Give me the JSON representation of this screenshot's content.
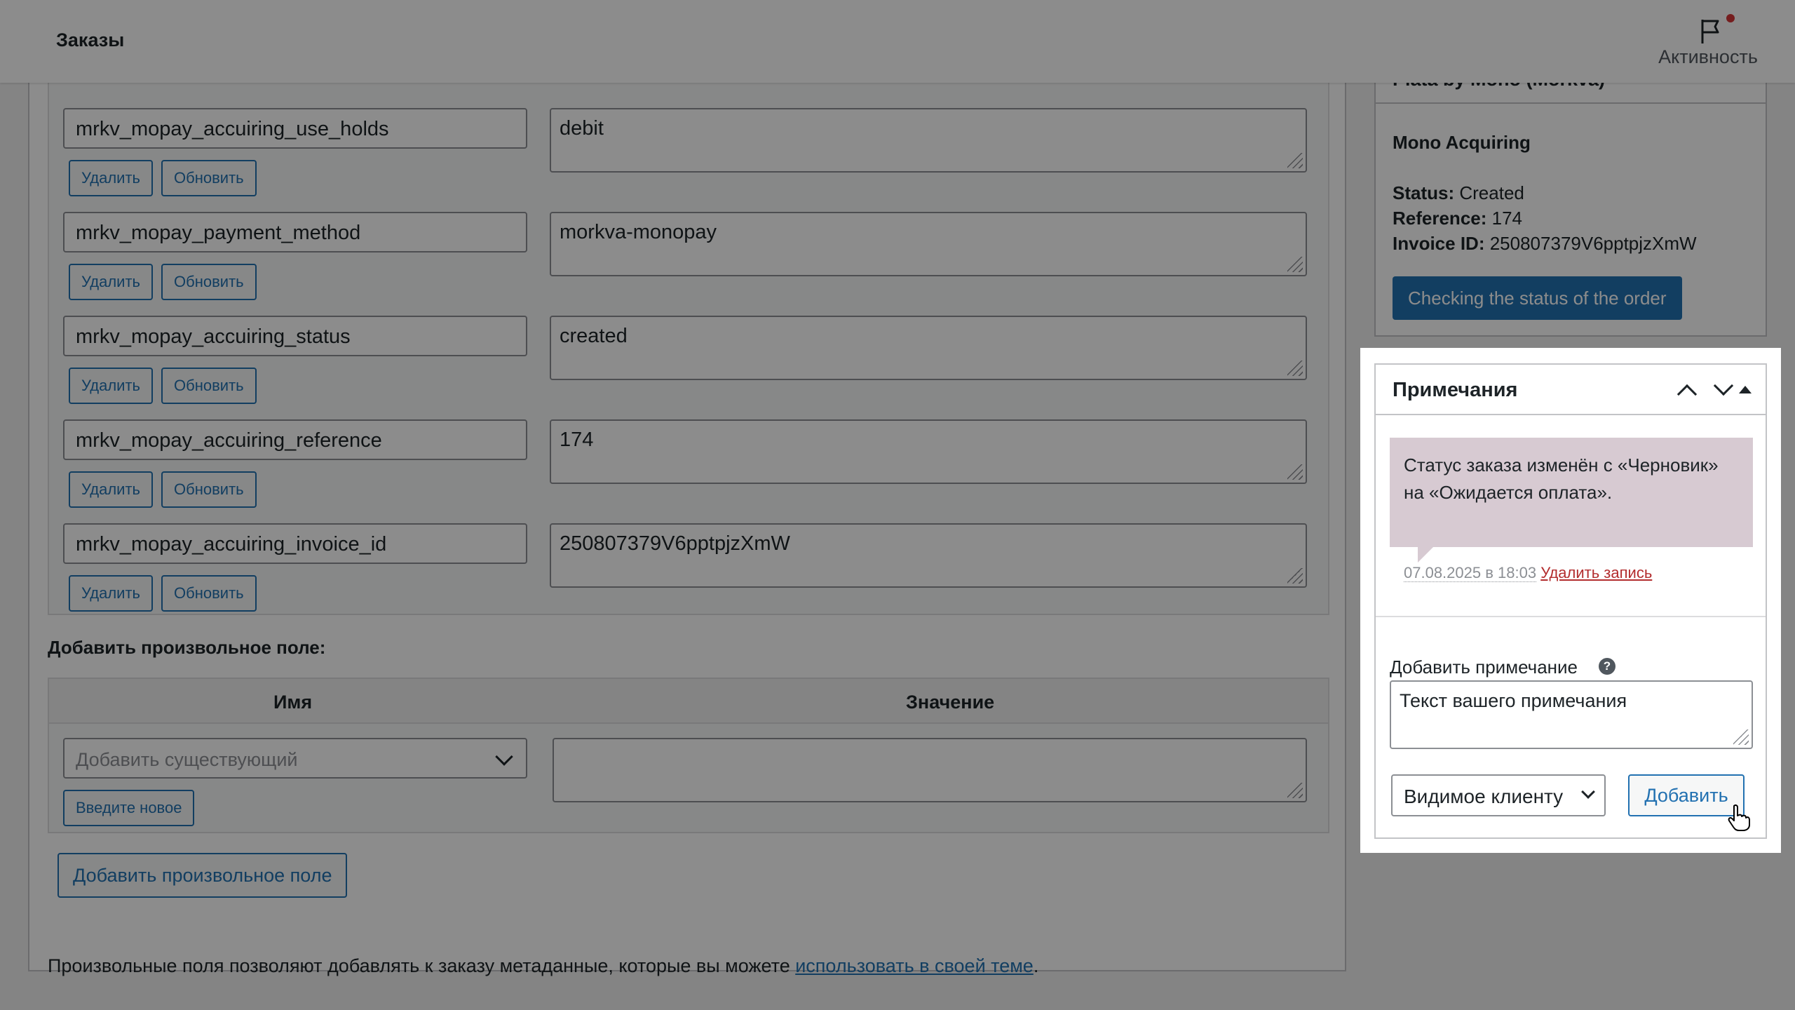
{
  "header": {
    "title": "Заказы",
    "activity_label": "Активность"
  },
  "meta_rows": [
    {
      "key": "mrkv_mopay_accuiring_use_holds",
      "value": "debit"
    },
    {
      "key": "mrkv_mopay_payment_method",
      "value": "morkva-monopay"
    },
    {
      "key": "mrkv_mopay_accuiring_status",
      "value": "created"
    },
    {
      "key": "mrkv_mopay_accuiring_reference",
      "value": "174"
    },
    {
      "key": "mrkv_mopay_accuiring_invoice_id",
      "value": "250807379V6pptpjzXmW"
    }
  ],
  "row_buttons": {
    "delete": "Удалить",
    "update": "Обновить"
  },
  "add_custom": {
    "heading": "Добавить произвольное поле:",
    "col_name": "Имя",
    "col_value": "Значение",
    "select_placeholder": "Добавить существующий",
    "enter_new": "Введите новое",
    "add_button": "Добавить произвольное поле"
  },
  "footnote": {
    "text": "Произвольные поля позволяют добавлять к заказу метаданные, которые вы можете ",
    "link": "использовать в своей теме",
    "end": "."
  },
  "mono": {
    "title": "Plata by Mono (Morkva)",
    "subtitle": "Mono Acquiring",
    "status_label": "Status:",
    "status_value": "Created",
    "reference_label": "Reference:",
    "reference_value": "174",
    "invoice_label": "Invoice ID:",
    "invoice_value": "250807379V6pptpjzXmW",
    "check_button": "Checking the status of the order"
  },
  "notes": {
    "title": "Примечания",
    "note_text": "Статус заказа изменён с «Черновик» на «Ожидается оплата».",
    "note_date": "07.08.2025 в 18:03",
    "delete_link": "Удалить запись",
    "add_label": "Добавить примечание",
    "help": "?",
    "input_value": "Текст вашего примечания",
    "type_selected": "Видимое клиенту",
    "add_button": "Добавить"
  },
  "colors": {
    "accent": "#2271b1",
    "note_bg": "#d7cad2",
    "danger": "#b32d2e",
    "notify_dot": "#d63638"
  }
}
